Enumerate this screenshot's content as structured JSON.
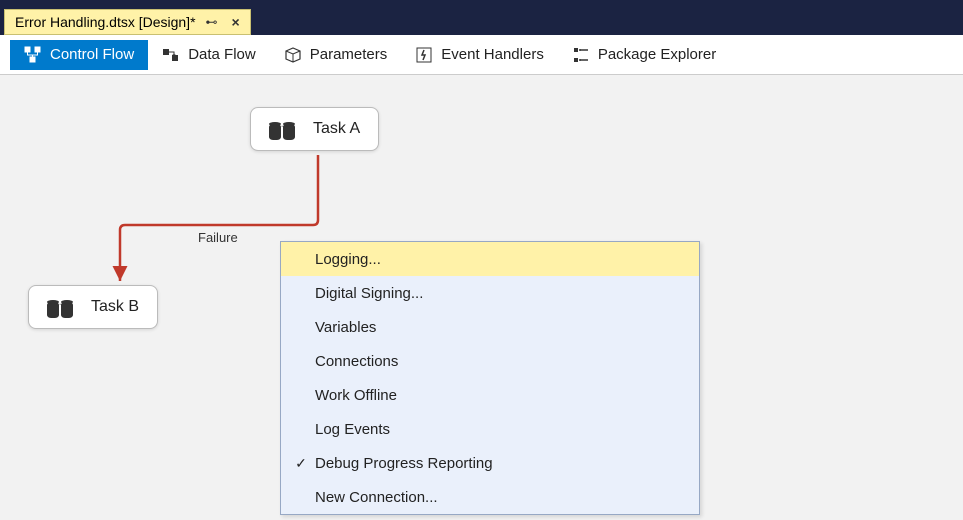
{
  "tab": {
    "title": "Error Handling.dtsx [Design]*"
  },
  "toolbar": {
    "items": [
      {
        "label": "Control Flow"
      },
      {
        "label": "Data Flow"
      },
      {
        "label": "Parameters"
      },
      {
        "label": "Event Handlers"
      },
      {
        "label": "Package Explorer"
      }
    ]
  },
  "nodes": {
    "taskA": "Task A",
    "taskB": "Task B"
  },
  "connector_label": "Failure",
  "context_menu": {
    "items": [
      {
        "label": "Logging...",
        "checked": false,
        "highlight": true
      },
      {
        "label": "Digital Signing...",
        "checked": false
      },
      {
        "label": "Variables",
        "checked": false
      },
      {
        "label": "Connections",
        "checked": false
      },
      {
        "label": "Work Offline",
        "checked": false
      },
      {
        "label": "Log Events",
        "checked": false
      },
      {
        "label": "Debug Progress Reporting",
        "checked": true
      },
      {
        "label": "New Connection...",
        "checked": false
      }
    ]
  }
}
